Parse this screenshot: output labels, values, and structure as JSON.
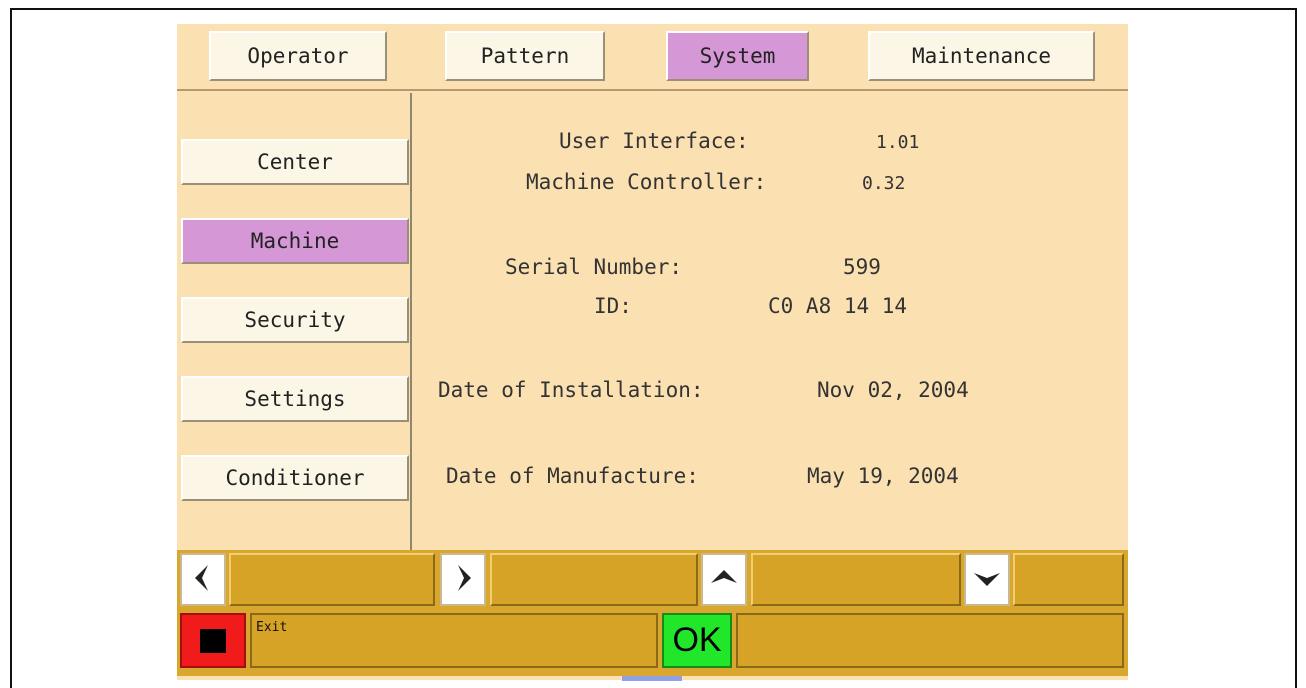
{
  "tabs": [
    {
      "label": "Operator"
    },
    {
      "label": "Pattern"
    },
    {
      "label": "System",
      "active": true
    },
    {
      "label": "Maintenance"
    }
  ],
  "sidebar": {
    "items": [
      {
        "label": "Center"
      },
      {
        "label": "Machine",
        "active": true
      },
      {
        "label": "Security"
      },
      {
        "label": "Settings"
      },
      {
        "label": "Conditioner"
      }
    ]
  },
  "info": {
    "user_interface_label": "User Interface:",
    "user_interface_value": "1.01",
    "machine_controller_label": "Machine Controller:",
    "machine_controller_value": "0.32",
    "serial_number_label": "Serial Number:",
    "serial_number_value": "599",
    "id_label": "ID:",
    "id_value": "C0 A8 14 14",
    "installation_label": "Date of Installation:",
    "installation_value": "Nov 02, 2004",
    "manufacture_label": "Date of Manufacture:",
    "manufacture_value": "May 19, 2004"
  },
  "actions": {
    "exit_label": "Exit",
    "ok_label": "OK"
  },
  "icons": {
    "left": "arrow-left-icon",
    "right": "arrow-right-icon",
    "up": "arrow-up-icon",
    "down": "arrow-down-icon",
    "stop": "stop-icon"
  },
  "colors": {
    "panel_bg": "#fbe0b2",
    "button_bg": "#fcf6e6",
    "active_bg": "#d597d6",
    "bar_bg": "#d9a72e",
    "stop": "#f21b1b",
    "ok": "#21e62a"
  }
}
